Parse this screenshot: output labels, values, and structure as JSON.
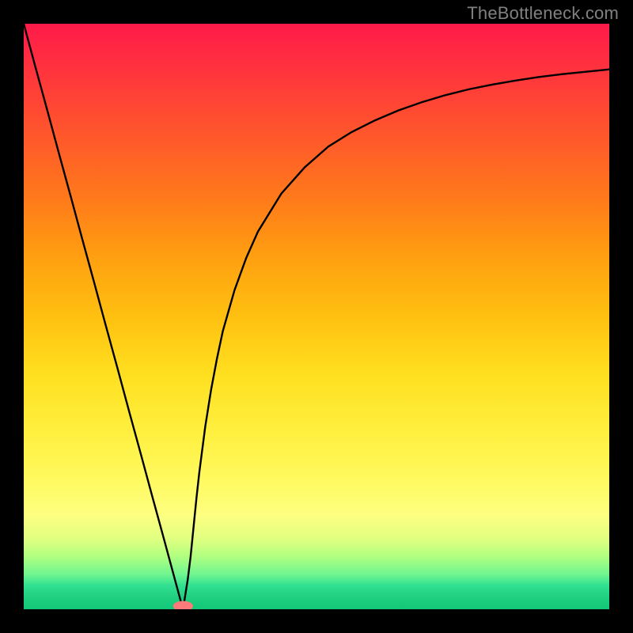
{
  "watermark": "TheBottleneck.com",
  "chart_data": {
    "type": "line",
    "x": [
      0.0,
      0.02,
      0.04,
      0.06,
      0.08,
      0.1,
      0.12,
      0.14,
      0.16,
      0.18,
      0.2,
      0.22,
      0.24,
      0.26,
      0.272,
      0.28,
      0.285,
      0.29,
      0.295,
      0.3,
      0.31,
      0.32,
      0.33,
      0.34,
      0.36,
      0.38,
      0.4,
      0.44,
      0.48,
      0.52,
      0.56,
      0.6,
      0.64,
      0.68,
      0.72,
      0.76,
      0.8,
      0.84,
      0.88,
      0.92,
      0.96,
      1.0
    ],
    "values": [
      1.0,
      0.926,
      0.853,
      0.779,
      0.706,
      0.632,
      0.559,
      0.485,
      0.412,
      0.338,
      0.265,
      0.191,
      0.118,
      0.044,
      0.0,
      0.05,
      0.09,
      0.14,
      0.19,
      0.235,
      0.312,
      0.375,
      0.428,
      0.475,
      0.545,
      0.6,
      0.645,
      0.71,
      0.755,
      0.79,
      0.815,
      0.835,
      0.852,
      0.866,
      0.878,
      0.888,
      0.896,
      0.903,
      0.909,
      0.914,
      0.918,
      0.922
    ],
    "marker_x": 0.272,
    "marker_y": 0.0,
    "xlim": [
      0,
      1
    ],
    "ylim": [
      0,
      1
    ],
    "xlabel": "",
    "ylabel": "",
    "title": ""
  },
  "colors": {
    "background": "#000000",
    "curve": "#000000",
    "marker": "#ff7a7a"
  }
}
